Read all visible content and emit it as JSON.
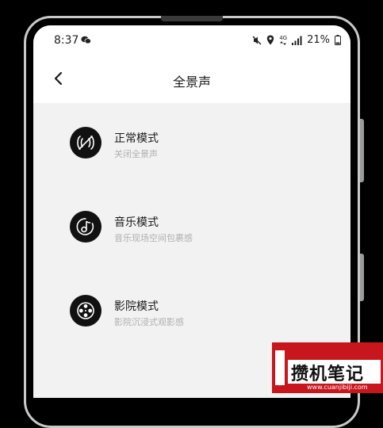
{
  "status_bar": {
    "time": "8:37",
    "network_type": "4G",
    "battery": "21%"
  },
  "header": {
    "title": "全景声"
  },
  "modes": [
    {
      "title": "正常模式",
      "subtitle": "关闭全景声",
      "icon": "surround-off-icon"
    },
    {
      "title": "音乐模式",
      "subtitle": "音乐现场空间包裹感",
      "icon": "music-note-icon"
    },
    {
      "title": "影院模式",
      "subtitle": "影院沉浸式观影感",
      "icon": "film-reel-icon"
    }
  ],
  "watermark": {
    "text": "攒机笔记",
    "url": "www.cuanjibiji.com"
  },
  "colors": {
    "background": "#f2f2f2",
    "header": "#ffffff",
    "icon_bg": "#111111",
    "subtitle": "#b0b0b0",
    "watermark_red": "#c8161d"
  }
}
